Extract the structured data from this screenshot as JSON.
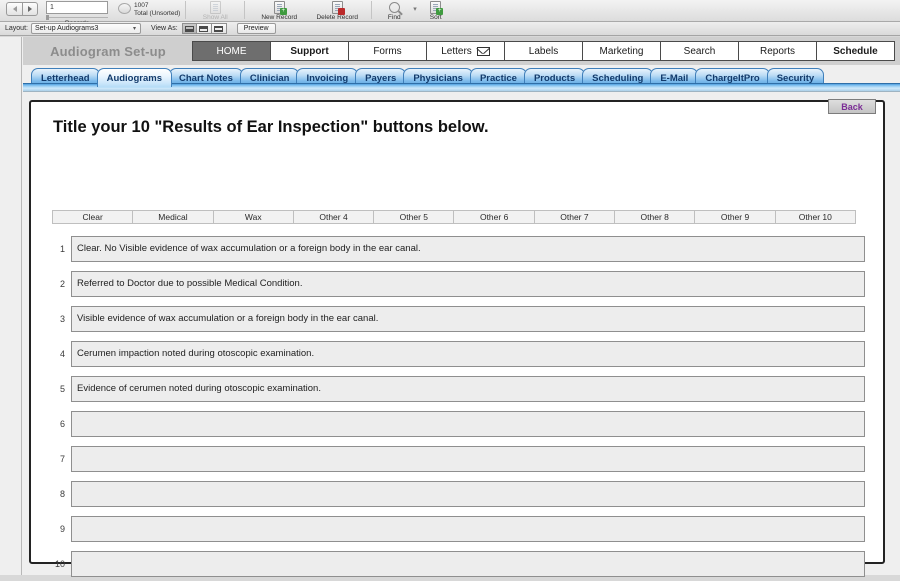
{
  "toolbar": {
    "record_value": "1",
    "records_label": "Records",
    "total_count": "1007",
    "total_label": "Total (Unsorted)",
    "buttons": [
      {
        "label": "Show All",
        "icon": "show-all-icon",
        "disabled": true
      },
      {
        "label": "New Record",
        "icon": "new-record-icon",
        "disabled": false
      },
      {
        "label": "Delete Record",
        "icon": "delete-record-icon",
        "disabled": false
      },
      {
        "label": "Find",
        "icon": "find-icon",
        "disabled": false
      },
      {
        "label": "Sort",
        "icon": "sort-icon",
        "disabled": false
      }
    ]
  },
  "layoutbar": {
    "layout_label": "Layout:",
    "layout_value": "Set-up Audiograms3",
    "viewas_label": "View As:",
    "view_modes": [
      "form-view",
      "list-view",
      "table-view"
    ],
    "active_view": "form-view",
    "preview_label": "Preview"
  },
  "header": {
    "app_title": "Audiogram Set-up",
    "main_nav": [
      {
        "label": "HOME",
        "state": "active"
      },
      {
        "label": "Support",
        "state": "bold"
      },
      {
        "label": "Forms",
        "state": "normal"
      },
      {
        "label": "Letters",
        "state": "normal",
        "icon": "envelope-icon"
      },
      {
        "label": "Labels",
        "state": "normal"
      },
      {
        "label": "Marketing",
        "state": "normal"
      },
      {
        "label": "Search",
        "state": "normal"
      },
      {
        "label": "Reports",
        "state": "normal"
      },
      {
        "label": "Schedule",
        "state": "bold"
      }
    ]
  },
  "subtabs": {
    "selected": "Audiograms",
    "items": [
      "Letterhead",
      "Audiograms",
      "Chart Notes",
      "Clinician",
      "Invoicing",
      "Payers",
      "Physicians",
      "Practice",
      "Products",
      "Scheduling",
      "E-Mail",
      "ChargeItPro",
      "Security"
    ]
  },
  "card": {
    "back_label": "Back",
    "title": "Title your 10 \"Results of Ear Inspection\" buttons below.",
    "column_headers": [
      "Clear",
      "Medical",
      "Wax",
      "Other 4",
      "Other 5",
      "Other 6",
      "Other 7",
      "Other 8",
      "Other 9",
      "Other 10"
    ],
    "rows": [
      {
        "num": "1",
        "value": "Clear. No Visible evidence of wax accumulation or a foreign body in the ear canal."
      },
      {
        "num": "2",
        "value": "Referred to Doctor due to possible Medical Condition."
      },
      {
        "num": "3",
        "value": "Visible evidence of wax accumulation or a foreign body in the ear canal."
      },
      {
        "num": "4",
        "value": "Cerumen impaction noted during otoscopic examination."
      },
      {
        "num": "5",
        "value": "Evidence of cerumen noted during otoscopic examination."
      },
      {
        "num": "6",
        "value": ""
      },
      {
        "num": "7",
        "value": ""
      },
      {
        "num": "8",
        "value": ""
      },
      {
        "num": "9",
        "value": ""
      },
      {
        "num": "10",
        "value": ""
      }
    ]
  },
  "colors": {
    "tab_blue": "#4f9fdf",
    "tab_text": "#123a6b",
    "back_purple": "#7b2d96",
    "active_nav": "#6e6e6e"
  }
}
